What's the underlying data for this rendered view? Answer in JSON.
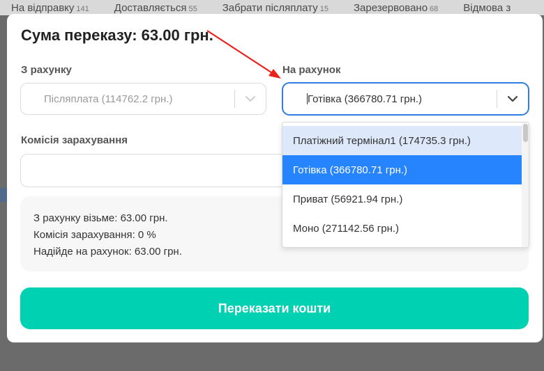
{
  "background_tabs": [
    {
      "label": "На відправку",
      "count": "141"
    },
    {
      "label": "Доставляється",
      "count": "55"
    },
    {
      "label": "Забрати післяплату",
      "count": "15"
    },
    {
      "label": "Зарезервовано",
      "count": "68"
    },
    {
      "label": "Відмова з",
      "count": ""
    }
  ],
  "modal": {
    "title": "Сума переказу: 63.00 грн.",
    "from_label": "З рахунку",
    "from_value": "Післяплата (114762.2 грн.)",
    "to_label": "На рахунок",
    "to_value": "Готівка (366780.71 грн.)",
    "commission_label": "Комісія зарахування",
    "commission_value": "",
    "summary": [
      "З рахунку візьме: 63.00 грн.",
      "Комісія зарахування: 0 %",
      "Надійде на рахунок: 63.00 грн."
    ],
    "submit_label": "Переказати кошти"
  },
  "dropdown": {
    "options": [
      {
        "label": "Платіжний термінал1 (174735.3 грн.)",
        "state": "hover"
      },
      {
        "label": "Готівка (366780.71 грн.)",
        "state": "selected"
      },
      {
        "label": "Приват (56921.94 грн.)",
        "state": ""
      },
      {
        "label": "Моно (271142.56 грн.)",
        "state": ""
      }
    ]
  },
  "colors": {
    "accent": "#00d1b2",
    "selected_option": "#2684ff",
    "hover_option": "#dde9fb",
    "focus_border": "#2f7de1",
    "annotation_arrow": "#e8231c"
  },
  "icons": [
    "chevron-down-icon",
    "chevron-down-icon",
    "red-arrow-annotation"
  ]
}
